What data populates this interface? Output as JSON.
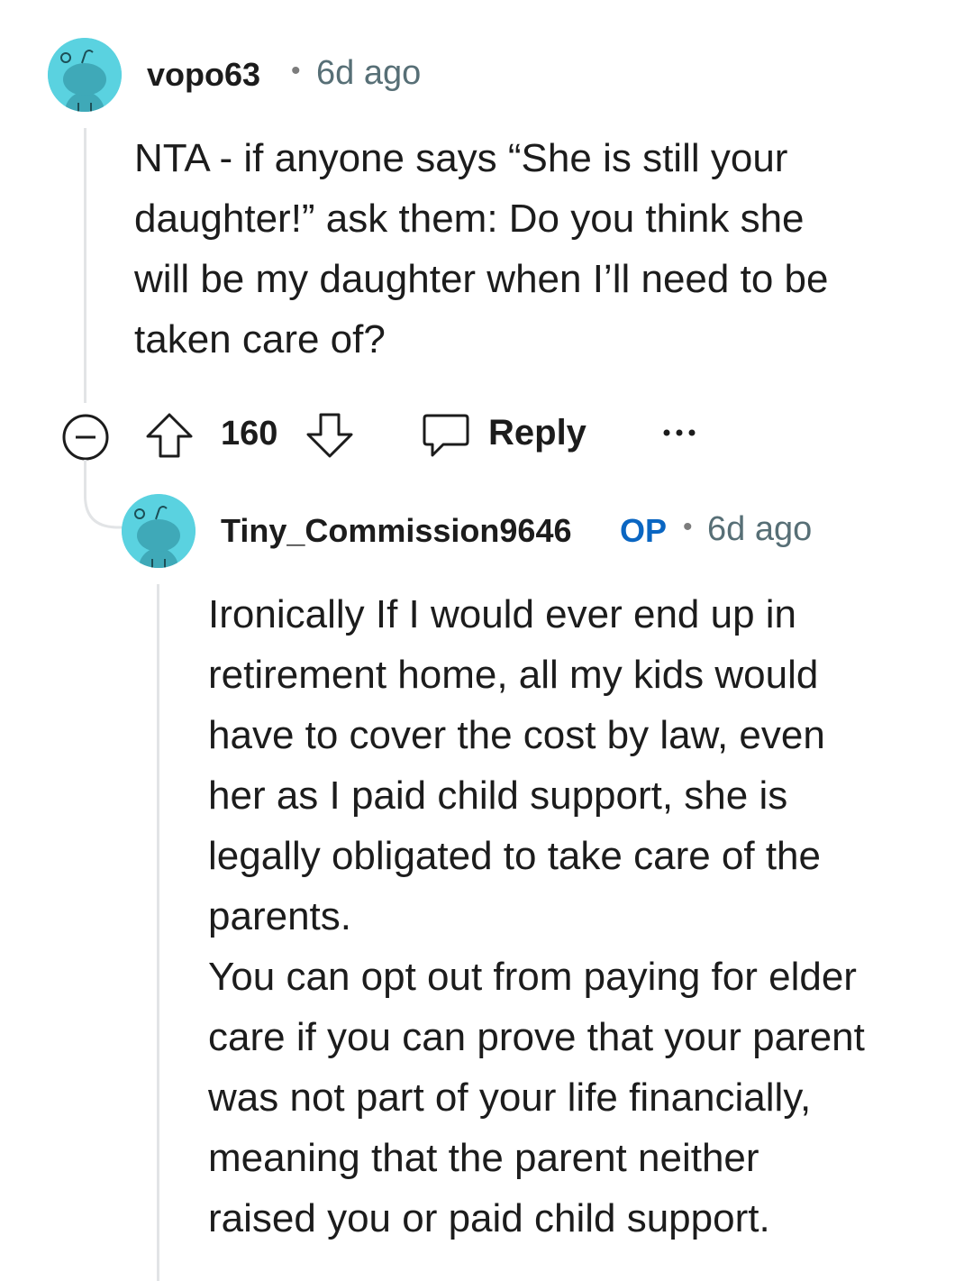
{
  "comments": [
    {
      "username": "vopo63",
      "separator": "•",
      "time": "6d ago",
      "body": "NTA - if anyone says “She is still your\ndaughter!” ask them: Do you think she\nwill be my daughter when I’ll need to be\ntaken care of?",
      "votes": "160",
      "reply_label": "Reply",
      "more_label": "•••"
    },
    {
      "username": "Tiny_Commission9646",
      "badge": "OP",
      "separator": "•",
      "time": "6d ago",
      "body": "Ironically If I would ever end up in\nretirement home, all my kids would\nhave to cover the cost by law, even\nher as I paid child support, she is\nlegally obligated to take care of the\nparents.\nYou can opt out from paying for elder\ncare if you can prove that your parent\nwas not part of your life financially,\nmeaning that the parent neither\nraised you or paid child support."
    }
  ],
  "icons": {
    "avatar": "snoo-avatar-icon",
    "collapse": "collapse-minus-icon",
    "upvote": "upvote-arrow-icon",
    "downvote": "downvote-arrow-icon",
    "reply": "speech-bubble-icon",
    "more": "more-options-icon"
  },
  "colors": {
    "avatar_bg": "#5ad2e0",
    "op_badge": "#0a66c2",
    "meta_text": "#576f76",
    "thread_line": "#e2e4e6"
  }
}
